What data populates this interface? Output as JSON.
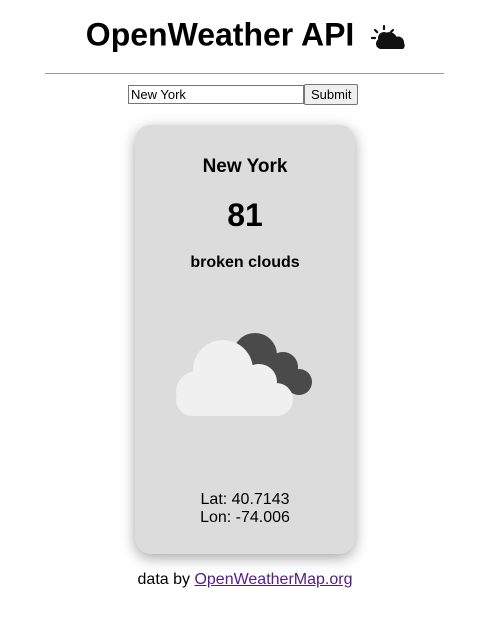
{
  "header": {
    "title": "OpenWeather API",
    "icon": "sun-behind-cloud-icon"
  },
  "search": {
    "value": "New York",
    "submit_label": "Submit"
  },
  "weather_card": {
    "city": "New York",
    "temperature": "81",
    "description": "broken clouds",
    "icon": "broken-clouds-icon",
    "latitude_text": "Lat: 40.7143",
    "longitude_text": "Lon: -74.006"
  },
  "footer": {
    "prefix": "data by ",
    "link_text": "OpenWeatherMap.org"
  },
  "colors": {
    "card_background": "#dcdcdc",
    "dark_cloud": "#4a4a4a",
    "light_cloud": "#f0f0f0",
    "link_visited": "#551a8b"
  }
}
